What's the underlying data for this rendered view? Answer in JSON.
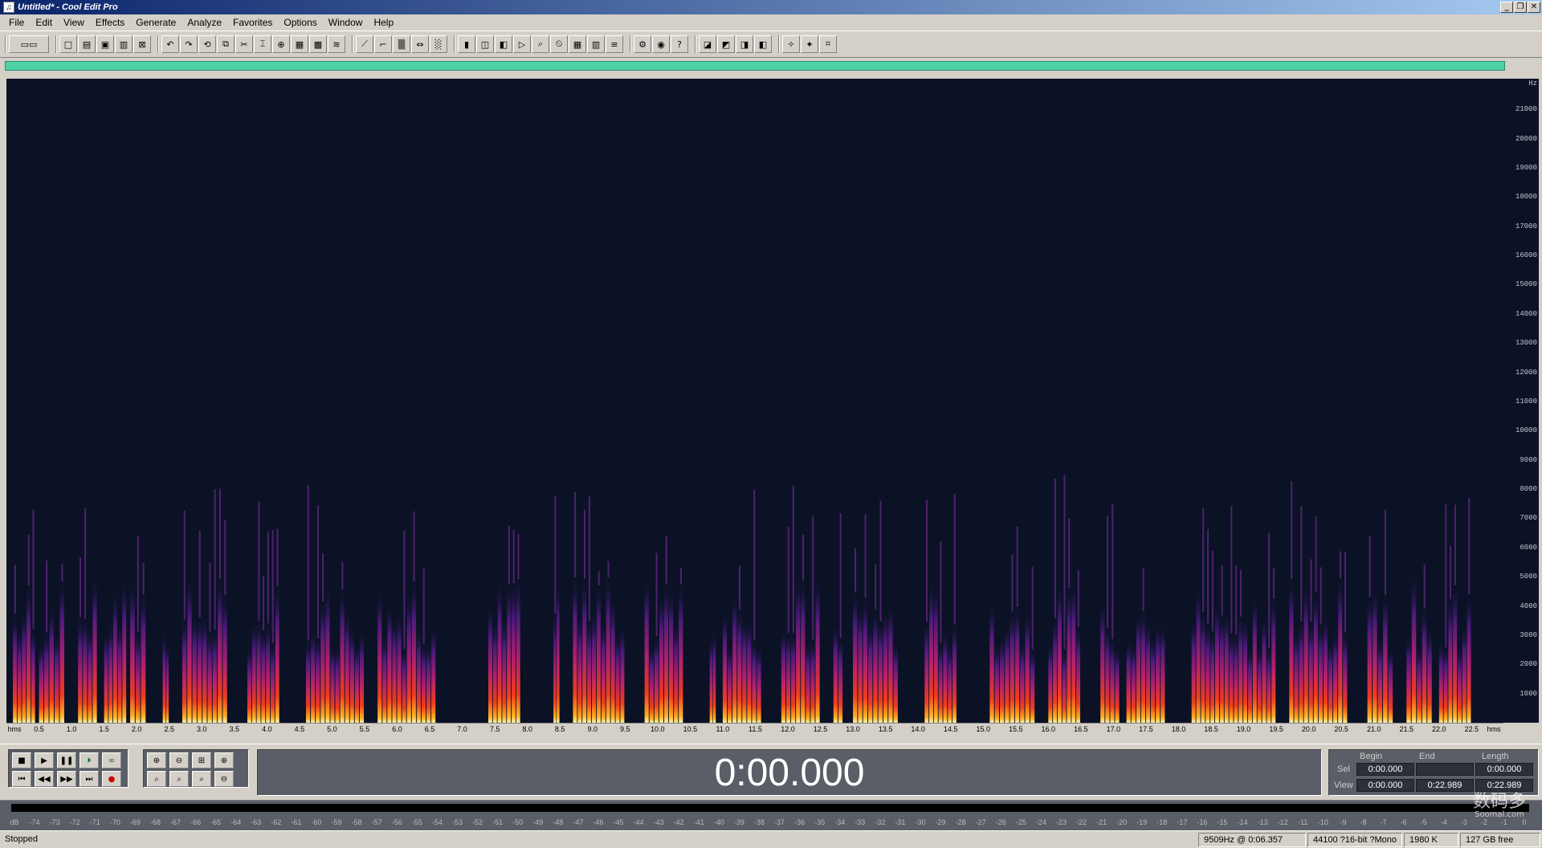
{
  "window": {
    "title": "Untitled* - Cool Edit Pro",
    "icon": "cool-edit-icon"
  },
  "menu": [
    "File",
    "Edit",
    "View",
    "Effects",
    "Generate",
    "Analyze",
    "Favorites",
    "Options",
    "Window",
    "Help"
  ],
  "toolbar_groups": [
    [
      "mode-toggle"
    ],
    [
      "new",
      "open",
      "save",
      "save-as",
      "close"
    ],
    [
      "undo",
      "redo",
      "repeat",
      "copy-new",
      "cut",
      "trim",
      "mix-paste",
      "paste",
      "paste-new",
      "mix"
    ],
    [
      "normalize",
      "envelope",
      "fade",
      "stretch",
      "noise"
    ],
    [
      "mark",
      "zoom-full",
      "zoom-sel",
      "play-sel",
      "scan",
      "time-fmt",
      "bits",
      "spectral",
      "waveform"
    ],
    [
      "settings",
      "cdplayer",
      "help"
    ],
    [
      "effect-1",
      "effect-2",
      "effect-3",
      "effect-4"
    ],
    [
      "tool-1",
      "tool-2",
      "tool-3"
    ]
  ],
  "spectrogram": {
    "freq_unit": "Hz",
    "freq_ticks": [
      "21000",
      "20000",
      "19000",
      "18000",
      "17000",
      "16000",
      "15000",
      "14000",
      "13000",
      "12000",
      "11000",
      "10000",
      "9000",
      "8000",
      "7000",
      "6000",
      "5000",
      "4000",
      "3000",
      "2000",
      "1000"
    ],
    "time_start_label": "hms",
    "time_end_label": "hms",
    "time_ticks": [
      "0.5",
      "1.0",
      "1.5",
      "2.0",
      "2.5",
      "3.0",
      "3.5",
      "4.0",
      "4.5",
      "5.0",
      "5.5",
      "6.0",
      "6.5",
      "7.0",
      "7.5",
      "8.0",
      "8.5",
      "9.0",
      "9.5",
      "10.0",
      "10.5",
      "11.0",
      "11.5",
      "12.0",
      "12.5",
      "13.0",
      "13.5",
      "14.0",
      "14.5",
      "15.0",
      "15.5",
      "16.0",
      "16.5",
      "17.0",
      "17.5",
      "18.0",
      "18.5",
      "19.0",
      "19.5",
      "20.0",
      "20.5",
      "21.0",
      "21.5",
      "22.0",
      "22.5"
    ],
    "bursts": [
      {
        "t": 0.1,
        "d": 0.35
      },
      {
        "t": 0.5,
        "d": 0.4
      },
      {
        "t": 1.1,
        "d": 0.3
      },
      {
        "t": 1.5,
        "d": 0.35
      },
      {
        "t": 1.9,
        "d": 0.25
      },
      {
        "t": 2.4,
        "d": 0.1
      },
      {
        "t": 2.7,
        "d": 0.7
      },
      {
        "t": 3.7,
        "d": 0.5
      },
      {
        "t": 4.6,
        "d": 0.9
      },
      {
        "t": 5.7,
        "d": 0.9
      },
      {
        "t": 7.4,
        "d": 0.5
      },
      {
        "t": 8.4,
        "d": 0.1
      },
      {
        "t": 8.7,
        "d": 0.8
      },
      {
        "t": 9.8,
        "d": 0.6
      },
      {
        "t": 10.8,
        "d": 0.1
      },
      {
        "t": 11.0,
        "d": 0.6
      },
      {
        "t": 11.9,
        "d": 0.6
      },
      {
        "t": 12.7,
        "d": 0.15
      },
      {
        "t": 13.0,
        "d": 0.7
      },
      {
        "t": 14.1,
        "d": 0.5
      },
      {
        "t": 15.1,
        "d": 0.7
      },
      {
        "t": 16.0,
        "d": 0.5
      },
      {
        "t": 16.8,
        "d": 0.3
      },
      {
        "t": 17.2,
        "d": 0.6
      },
      {
        "t": 18.2,
        "d": 1.3
      },
      {
        "t": 19.7,
        "d": 0.9
      },
      {
        "t": 20.9,
        "d": 0.4
      },
      {
        "t": 21.5,
        "d": 0.4
      },
      {
        "t": 22.0,
        "d": 0.5
      }
    ]
  },
  "transport": {
    "buttons": [
      "stop",
      "play",
      "pause",
      "play-to-end",
      "loop",
      "go-start",
      "rewind",
      "fast-forward",
      "go-end",
      "record"
    ],
    "zoom_buttons": [
      "zoom-in-h",
      "zoom-out-h",
      "zoom-full-h",
      "zoom-in-v",
      "zoom-left",
      "zoom-right",
      "zoom-sel",
      "zoom-out-v"
    ]
  },
  "time_display": "0:00.000",
  "selview": {
    "headers": [
      "Begin",
      "End",
      "Length"
    ],
    "sel_label": "Sel",
    "view_label": "View",
    "sel": [
      "0:00.000",
      "",
      "0:00.000"
    ],
    "view": [
      "0:00.000",
      "0:22.989",
      "0:22.989"
    ]
  },
  "meter_ticks": [
    "dB",
    "-74",
    "-73",
    "-72",
    "-71",
    "-70",
    "-69",
    "-68",
    "-67",
    "-66",
    "-65",
    "-64",
    "-63",
    "-62",
    "-61",
    "-60",
    "-59",
    "-58",
    "-57",
    "-56",
    "-55",
    "-54",
    "-53",
    "-52",
    "-51",
    "-50",
    "-49",
    "-48",
    "-47",
    "-46",
    "-45",
    "-44",
    "-43",
    "-42",
    "-41",
    "-40",
    "-39",
    "-38",
    "-37",
    "-36",
    "-35",
    "-34",
    "-33",
    "-32",
    "-31",
    "-30",
    "-29",
    "-28",
    "-27",
    "-26",
    "-25",
    "-24",
    "-23",
    "-22",
    "-21",
    "-20",
    "-19",
    "-18",
    "-17",
    "-16",
    "-15",
    "-14",
    "-13",
    "-12",
    "-11",
    "-10",
    "-9",
    "-8",
    "-7",
    "-6",
    "-5",
    "-4",
    "-3",
    "-2",
    "-1",
    "0"
  ],
  "status": {
    "state": "Stopped",
    "cursor": "9509Hz @   0:06.357",
    "format": "44100 ?16-bit ?Mono",
    "size": "1980 K",
    "free": "127 GB free"
  },
  "watermark": {
    "text": "数码多",
    "sub": "Soomal.com"
  }
}
